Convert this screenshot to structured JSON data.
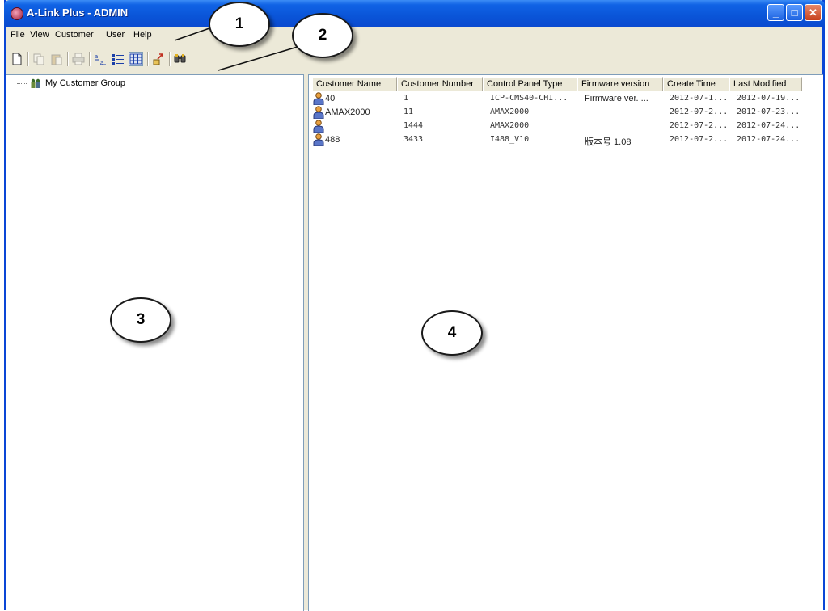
{
  "window": {
    "title": "A-Link Plus - ADMIN"
  },
  "menu": [
    "File",
    "View",
    "Customer",
    "User",
    "Help"
  ],
  "toolbar": [
    "new-icon",
    "copy-icon",
    "paste-icon",
    "print-icon",
    "sort-icon",
    "details-view-icon",
    "grid-view-icon",
    "export-icon",
    "find-icon"
  ],
  "tree": {
    "root_label": "My Customer Group"
  },
  "table": {
    "columns": [
      "Customer Name",
      "Customer Number",
      "Control Panel Type",
      "Firmware version",
      "Create Time",
      "Last Modified"
    ],
    "rows": [
      [
        "40",
        "1",
        "ICP-CMS40-CHI...",
        "Firmware ver. ...",
        "2012-07-1...",
        "2012-07-19..."
      ],
      [
        "AMAX2000",
        "11",
        "AMAX2000",
        "",
        "2012-07-2...",
        "2012-07-23..."
      ],
      [
        "",
        "1444",
        "AMAX2000",
        "",
        "2012-07-2...",
        "2012-07-24..."
      ],
      [
        "488",
        "3433",
        "I488_V10",
        "版本号 1.08",
        "2012-07-2...",
        "2012-07-24..."
      ]
    ]
  },
  "callouts": [
    "1",
    "2",
    "3",
    "4"
  ],
  "colors": {
    "titlebar": "#0a55d8",
    "chrome": "#ece9d8",
    "close": "#c7401c"
  }
}
